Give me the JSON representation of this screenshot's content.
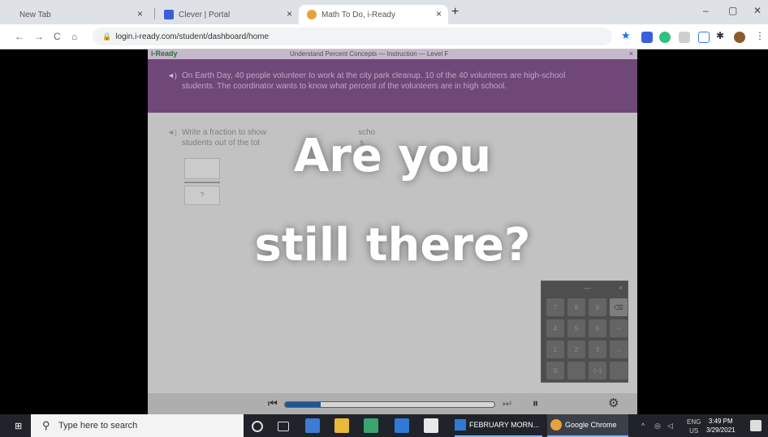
{
  "browser": {
    "tabs": [
      {
        "title": "New Tab",
        "icon": "blank-icon",
        "active": false
      },
      {
        "title": "Clever | Portal",
        "icon": "clever-icon",
        "active": false
      },
      {
        "title": "Math To Do, i-Ready",
        "icon": "iready-icon",
        "active": true
      }
    ],
    "new_tab_label": "+",
    "url": "login.i-ready.com/student/dashboard/home",
    "window_controls": {
      "minimize": "–",
      "maximize": "▢",
      "close": "✕"
    },
    "nav": {
      "back": "←",
      "forward": "→",
      "reload": "C",
      "home": "⌂"
    }
  },
  "lesson": {
    "brand": "i-Ready",
    "title": "Understand Percent Concepts — Instruction — Level F",
    "close": "×",
    "prompt": "On Earth Day, 40 people volunteer to work at the city park cleanup. 10 of the 40 volunteers are high-school students. The coordinator wants to know what percent of the volunteers are in high school.",
    "question_part1": "Write a fraction to show",
    "question_part2": "scho",
    "question_line2a": "students out of the tot",
    "question_line2b": "s.",
    "fraction_denominator": "?",
    "overlay_line1": "Are you",
    "overlay_line2": "still there?",
    "speaker_icon": "◄)",
    "keypad": {
      "minimize": "—",
      "close": "×",
      "keys": [
        "7",
        "8",
        "9",
        "⌫",
        "4",
        "5",
        "6",
        "–",
        "1",
        "2",
        "3",
        "→",
        "0",
        ".",
        "(–)",
        ""
      ]
    },
    "player": {
      "progress": 0.17,
      "prev": "⏮",
      "next": "⏭",
      "pause": "⏸",
      "settings": "⚙"
    }
  },
  "taskbar": {
    "search_placeholder": "Type here to search",
    "items": [
      {
        "label": "FEBRUARY MORN..."
      },
      {
        "label": "Google Chrome"
      }
    ],
    "lang": "ENG",
    "region": "US",
    "time": "3:49 PM",
    "date": "3/29/2021"
  },
  "colors": {
    "prompt_bg": "#7a4f82",
    "progress_fill": "#1f5fa0",
    "taskbar_bg": "#20232a"
  }
}
